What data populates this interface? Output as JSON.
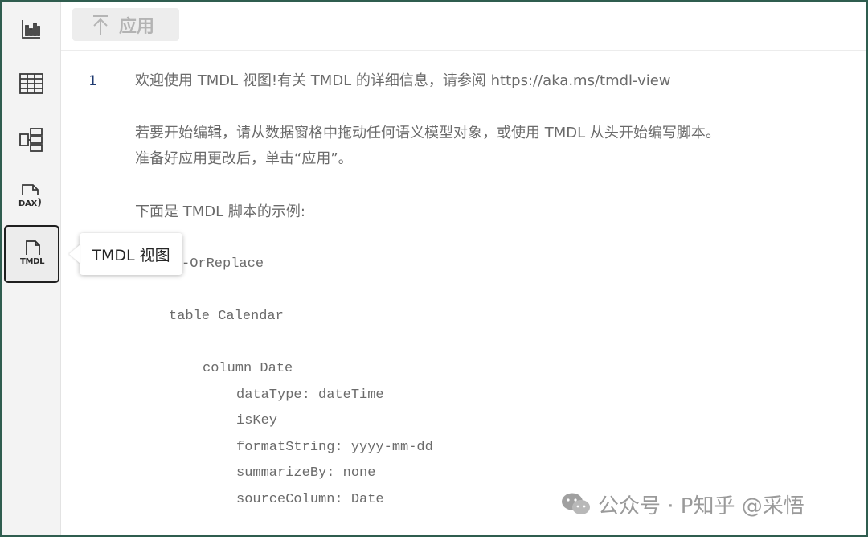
{
  "toolbar": {
    "apply_label": "应用"
  },
  "sidebar": {
    "items": [
      {
        "name": "report-view",
        "icon": "bar-chart-icon"
      },
      {
        "name": "table-view",
        "icon": "table-grid-icon"
      },
      {
        "name": "model-view",
        "icon": "model-diagram-icon"
      },
      {
        "name": "dax-query-view",
        "icon": "dax-icon",
        "label": "DAX"
      },
      {
        "name": "tmdl-view",
        "icon": "tmdl-icon",
        "label": "TMDL",
        "active": true
      }
    ]
  },
  "tooltip": {
    "text": "TMDL 视图"
  },
  "editor": {
    "line_number": "1",
    "intro": "欢迎使用 TMDL 视图!有关 TMDL 的详细信息，请参阅 https://aka.ms/tmdl-view",
    "instructions_1": "若要开始编辑，请从数据窗格中拖动任何语义模型对象，或使用 TMDL 从头开始编写脚本。",
    "instructions_2": "准备好应用更改后，单击“应用”。",
    "example_heading": "下面是 TMDL 脚本的示例:",
    "code_lines": [
      "-OrReplace",
      "table Calendar",
      "column Date",
      "dataType: dateTime",
      "isKey",
      "formatString: yyyy-mm-dd",
      "summarizeBy: none",
      "sourceColumn: Date"
    ]
  },
  "watermark": {
    "text": "公众号 · P知乎 @采悟"
  },
  "colors": {
    "frame_border": "#2f5d4f",
    "line_number": "#1f3a70",
    "code_text": "#6b6b6b"
  }
}
